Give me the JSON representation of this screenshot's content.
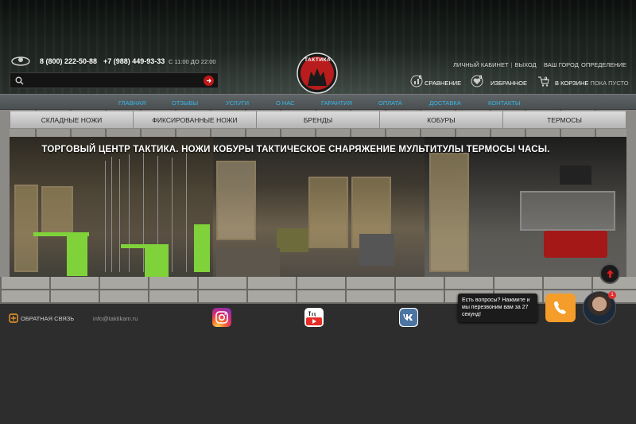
{
  "header": {
    "phone_primary": "8 (800) 222-50-88",
    "phone_secondary": "+7 (988) 449-93-33",
    "hours": "С 11:00 ДО 22:00",
    "search_placeholder": "",
    "logo_text": "ТАКТИКА",
    "account_link": "ЛИЧНЫЙ КАБИНЕТ",
    "logout_link": "ВЫХОД",
    "city_label": "ВАШ ГОРОД",
    "city_value": "ОПРЕДЕЛЕНИЕ",
    "compare": {
      "label": "СРАВНЕНИЕ",
      "count": "0"
    },
    "favorites": {
      "label": "ИЗБРАННОЕ",
      "count": "0"
    },
    "cart": {
      "label": "В КОРЗИНЕ",
      "status": "ПОКА ПУСТО",
      "count": "0"
    },
    "accent_color": "#c01818"
  },
  "topnav": {
    "items": [
      "ГЛАВНАЯ",
      "ОТЗЫВЫ",
      "УСЛУГИ",
      "О НАС",
      "ГАРАНТИЯ",
      "ОПЛАТА",
      "ДОСТАВКА",
      "КОНТАКТЫ"
    ],
    "link_color": "#38b6e8"
  },
  "categories": [
    "СКЛАДНЫЕ НОЖИ",
    "ФИКСИРОВАННЫЕ НОЖИ",
    "БРЕНДЫ",
    "КОБУРЫ",
    "ТЕРМОСЫ"
  ],
  "banner": {
    "title": "ТОРГОВЫЙ ЦЕНТР ТАКТИКА.  НОЖИ  КОБУРЫ  ТАКТИЧЕСКОЕ СНАРЯЖЕНИЕ  МУЛЬТИТУЛЫ  ТЕРМОСЫ  ЧАСЫ."
  },
  "footer": {
    "feedback": "ОБРАТНАЯ СВЯЗЬ",
    "email": "info@taktikam.ru",
    "social": [
      "instagram-icon",
      "youtube-icon",
      "vk-icon"
    ]
  },
  "chat": {
    "message": "Есть вопросы? Нажмите и мы перезвоним вам за 27 секунд!",
    "badge": "1",
    "button_color": "#f49d2a"
  }
}
